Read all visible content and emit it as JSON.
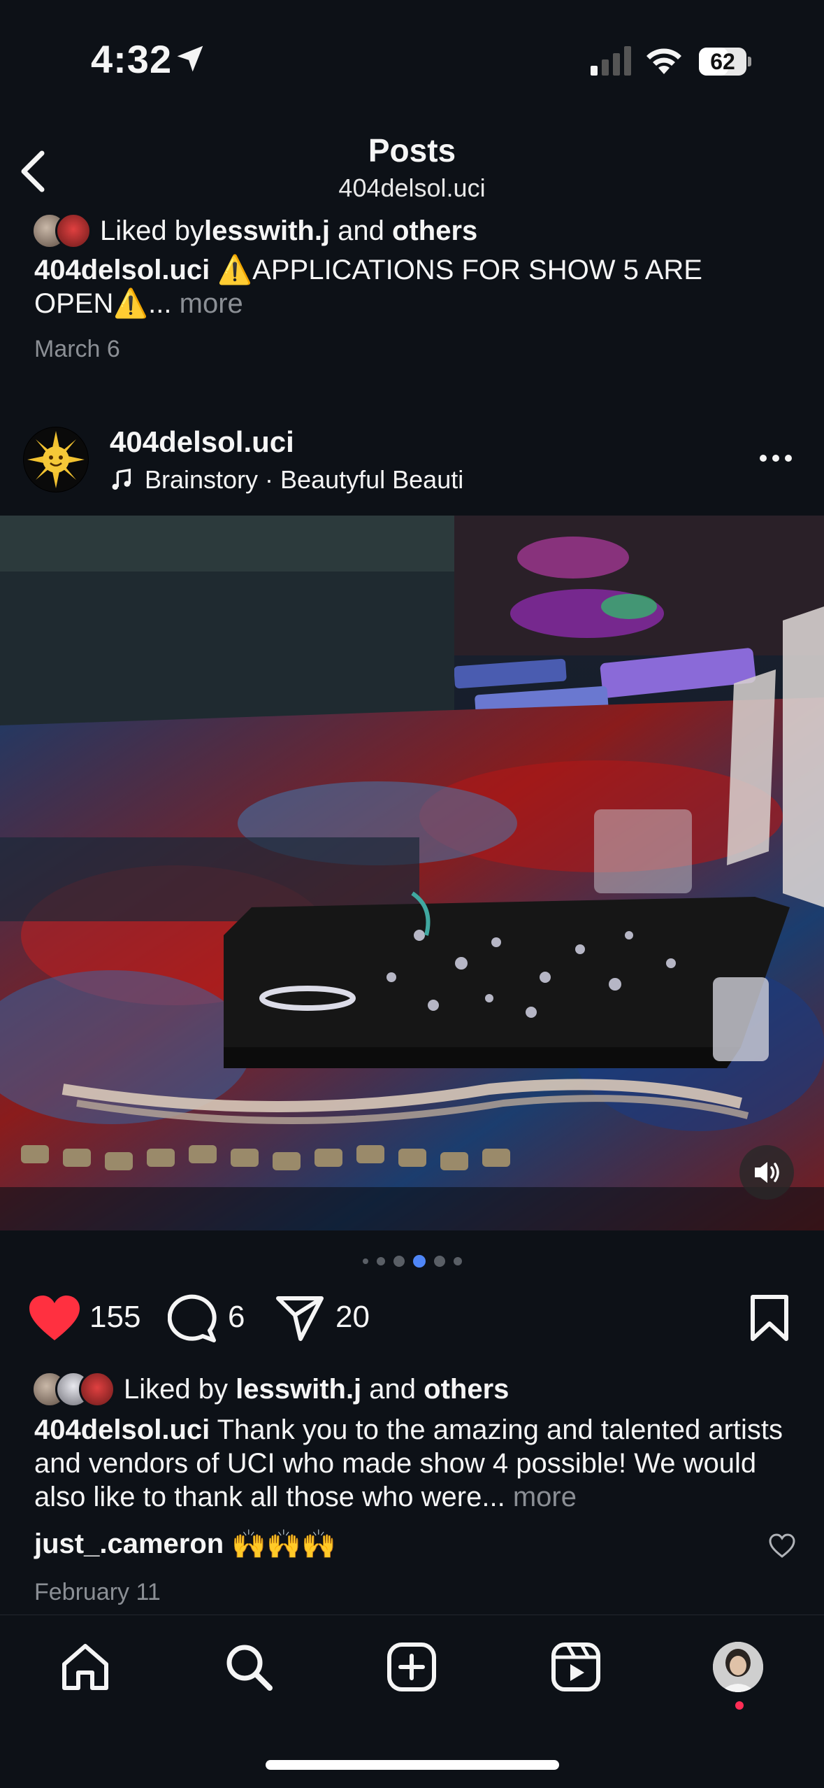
{
  "status_bar": {
    "time": "4:32",
    "battery": "62",
    "battery_level": 0.62
  },
  "header": {
    "title": "Posts",
    "subtitle": "404delsol.uci"
  },
  "previous_post": {
    "liked_prefix": "Liked by ",
    "liked_user": "lesswith.j",
    "liked_and": " and ",
    "liked_others": "others",
    "caption_user": "404delsol.uci",
    "caption_text": " ⚠️APPLICATIONS FOR SHOW 5 ARE OPEN⚠️",
    "caption_ellipsis": "... ",
    "more": "more",
    "date": "March 6"
  },
  "post": {
    "username": "404delsol.uci",
    "audio": "Brainstory · Beautyful Beauti",
    "carousel": {
      "count": 6,
      "active": 3
    },
    "likes": "155",
    "comments": "6",
    "shares": "20",
    "liked_prefix": "Liked by ",
    "liked_user": "lesswith.j",
    "liked_and": " and ",
    "liked_others": "others",
    "caption_user": "404delsol.uci",
    "caption_text": " Thank you to the amazing and talented artists and vendors of UCI who made show 4 possible! We would also like to thank all those who were",
    "caption_ellipsis": "... ",
    "more": "more",
    "top_comment_user": "just_.cameron",
    "top_comment_text": " 🙌🙌🙌",
    "date": "February 11"
  },
  "colors": {
    "background": "#0d1117",
    "like_red": "#ff3040",
    "active_dot": "#4f86f7",
    "muted_text": "#8b8f95"
  },
  "icons": {
    "back": "chevron-left-icon",
    "more": "more-horizontal-icon",
    "like": "heart-filled-icon",
    "comment": "comment-bubble-icon",
    "share": "paper-plane-icon",
    "save": "bookmark-icon",
    "mute": "speaker-icon",
    "tabs": [
      "home-icon",
      "search-icon",
      "create-post-icon",
      "reels-icon",
      "profile-avatar"
    ]
  }
}
